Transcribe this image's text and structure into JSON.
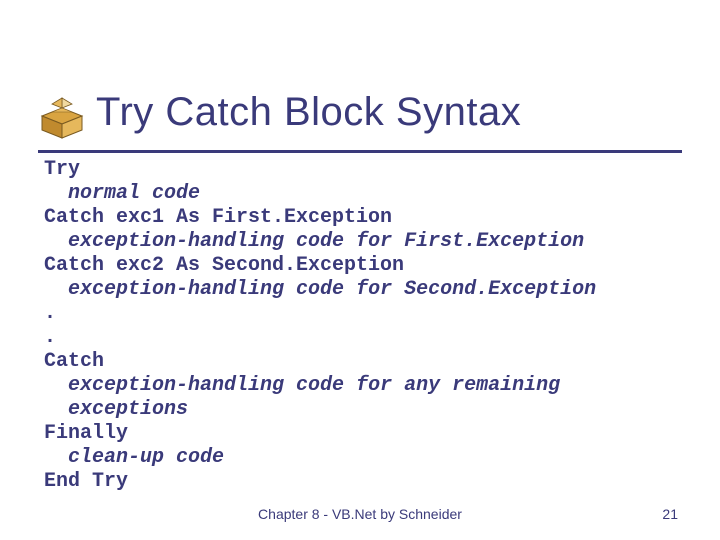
{
  "title": "Try Catch Block Syntax",
  "code": {
    "l0_kw": "Try",
    "l1_it": "normal code",
    "l2_kw": "Catch exc1 As First.Exception",
    "l3_it": "exception-handling code for First.Exception",
    "l4_kw": "Catch exc2 As Second.Exception",
    "l5_it": "exception-handling code for Second.Exception",
    "l6": ".",
    "l7": ".",
    "l8_kw": "Catch",
    "l9_it": "exception-handling code for any remaining",
    "l10_it": "exceptions",
    "l11_kw": "Finally",
    "l12_it": "clean-up code",
    "l13_kw": "End Try"
  },
  "footer": "Chapter 8 - VB.Net by Schneider",
  "page": "21"
}
